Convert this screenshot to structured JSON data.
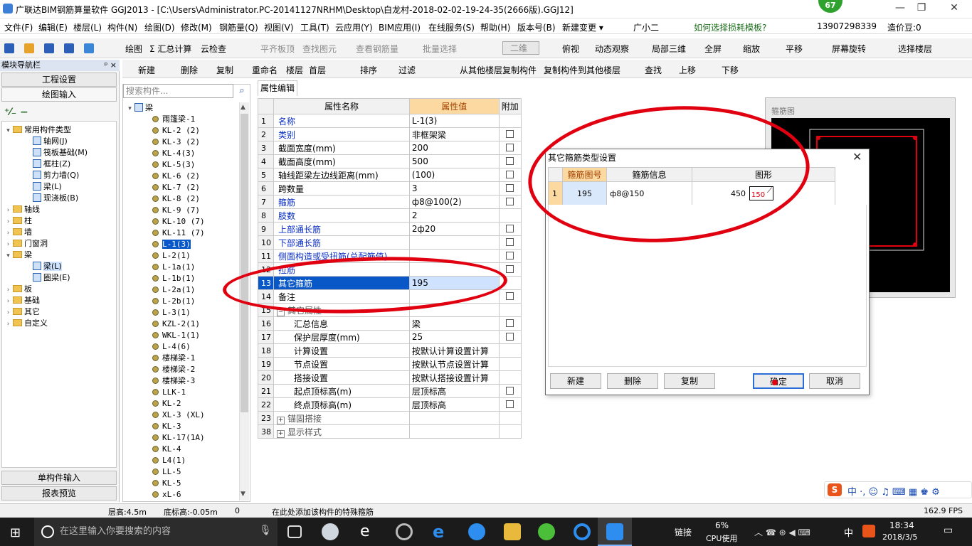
{
  "titlebar": {
    "title": "广联达BIM钢筋算量软件 GGJ2013 - [C:\\Users\\Administrator.PC-20141127NRHM\\Desktop\\白龙村-2018-02-02-19-24-35(2666版).GGJ12]",
    "badge": "67",
    "min": "—",
    "max": "❐",
    "close": "✕"
  },
  "menu": [
    "文件(F)",
    "编辑(E)",
    "楼层(L)",
    "构件(N)",
    "绘图(D)",
    "修改(M)",
    "钢筋量(Q)",
    "视图(V)",
    "工具(T)",
    "云应用(Y)",
    "BIM应用(I)",
    "在线服务(S)",
    "帮助(H)",
    "版本号(B)",
    "新建变更 ▾",
    "广小二",
    "如何选择损耗模板?",
    "13907298339",
    "造价豆:0"
  ],
  "toolbar1": [
    "绘图",
    "Σ 汇总计算",
    "云检查",
    "平齐板顶",
    "查找图元",
    "查看钢筋量",
    "批量选择",
    "二维",
    "俯视",
    "动态观察",
    "局部三维",
    "全屏",
    "缩放",
    "平移",
    "屏幕旋转",
    "选择楼层"
  ],
  "toolbar2": [
    "新建",
    "删除",
    "复制",
    "重命名",
    "楼层",
    "首层",
    "排序",
    "过滤",
    "从其他楼层复制构件",
    "复制构件到其他楼层",
    "查找",
    "上移",
    "下移"
  ],
  "nav": {
    "header": "模块导航栏",
    "pin": "ᵖ ×",
    "btn1": "工程设置",
    "btn2": "绘图输入",
    "btn3": "单构件输入",
    "btn4": "报表预览",
    "tree": [
      {
        "t": "常用构件类型",
        "lvl": 0,
        "f": true,
        "e": "▾"
      },
      {
        "t": "轴网(J)",
        "lvl": 2,
        "f": false,
        "e": ""
      },
      {
        "t": "筏板基础(M)",
        "lvl": 2,
        "f": false,
        "e": ""
      },
      {
        "t": "框柱(Z)",
        "lvl": 2,
        "f": false,
        "e": ""
      },
      {
        "t": "剪力墙(Q)",
        "lvl": 2,
        "f": false,
        "e": ""
      },
      {
        "t": "梁(L)",
        "lvl": 2,
        "f": false,
        "e": ""
      },
      {
        "t": "现浇板(B)",
        "lvl": 2,
        "f": false,
        "e": ""
      },
      {
        "t": "轴线",
        "lvl": 0,
        "f": true,
        "e": "›"
      },
      {
        "t": "柱",
        "lvl": 0,
        "f": true,
        "e": "›"
      },
      {
        "t": "墙",
        "lvl": 0,
        "f": true,
        "e": "›"
      },
      {
        "t": "门窗洞",
        "lvl": 0,
        "f": true,
        "e": "›"
      },
      {
        "t": "梁",
        "lvl": 0,
        "f": true,
        "e": "▾"
      },
      {
        "t": "梁(L)",
        "lvl": 2,
        "f": false,
        "e": ""
      },
      {
        "t": "圈梁(E)",
        "lvl": 2,
        "f": false,
        "e": ""
      },
      {
        "t": "板",
        "lvl": 0,
        "f": true,
        "e": "›"
      },
      {
        "t": "基础",
        "lvl": 0,
        "f": true,
        "e": "›"
      },
      {
        "t": "其它",
        "lvl": 0,
        "f": true,
        "e": "›"
      },
      {
        "t": "自定义",
        "lvl": 0,
        "f": true,
        "e": "›"
      }
    ]
  },
  "list": {
    "search_placeholder": "搜索构件...",
    "root": "梁",
    "items": [
      "雨篷梁-1",
      "KL-2 (2)",
      "KL-3 (2)",
      "KL-4(3)",
      "KL-5(3)",
      "KL-6 (2)",
      "KL-7 (2)",
      "KL-8 (2)",
      "KL-9 (7)",
      "KL-10 (7)",
      "KL-11 (7)",
      "L-1(3)",
      "L-2(1)",
      "L-1a(1)",
      "L-1b(1)",
      "L-2a(1)",
      "L-2b(1)",
      "L-3(1)",
      "KZL-2(1)",
      "WKL-1(1)",
      "L-4(6)",
      "楼梯梁-1",
      "楼梯梁-2",
      "楼梯梁-3",
      "LLK-1",
      "KL-2",
      "XL-3 (XL)",
      "KL-3",
      "KL-17(1A)",
      "KL-4",
      "L4(1)",
      "LL-5",
      "KL-5",
      "xL-6"
    ],
    "selected": 11
  },
  "props": {
    "tab": "属性编辑",
    "h_name": "属性名称",
    "h_value": "属性值",
    "h_extra": "附加",
    "rows": [
      {
        "n": "1",
        "k": "名称",
        "v": "L-1(3)",
        "blue": true,
        "cb": false,
        "ind": 0
      },
      {
        "n": "2",
        "k": "类别",
        "v": "非框架梁",
        "blue": true,
        "cb": true,
        "ind": 0
      },
      {
        "n": "3",
        "k": "截面宽度(mm)",
        "v": "200",
        "blue": false,
        "cb": true,
        "ind": 0
      },
      {
        "n": "4",
        "k": "截面高度(mm)",
        "v": "500",
        "blue": false,
        "cb": true,
        "ind": 0
      },
      {
        "n": "5",
        "k": "轴线距梁左边线距离(mm)",
        "v": "(100)",
        "blue": false,
        "cb": true,
        "ind": 0
      },
      {
        "n": "6",
        "k": "跨数量",
        "v": "3",
        "blue": false,
        "cb": true,
        "ind": 0
      },
      {
        "n": "7",
        "k": "箍筋",
        "v": "ф8@100(2)",
        "blue": true,
        "cb": true,
        "ind": 0
      },
      {
        "n": "8",
        "k": "肢数",
        "v": "2",
        "blue": true,
        "cb": false,
        "ind": 0
      },
      {
        "n": "9",
        "k": "上部通长筋",
        "v": "2ф20",
        "blue": true,
        "cb": true,
        "ind": 0
      },
      {
        "n": "10",
        "k": "下部通长筋",
        "v": "",
        "blue": true,
        "cb": true,
        "ind": 0
      },
      {
        "n": "11",
        "k": "侧面构造或受扭筋(总配筋值)",
        "v": "",
        "blue": true,
        "cb": true,
        "ind": 0
      },
      {
        "n": "12",
        "k": "拉筋",
        "v": "",
        "blue": true,
        "cb": true,
        "ind": 0
      },
      {
        "n": "13",
        "k": "其它箍筋",
        "v": "195",
        "blue": false,
        "cb": false,
        "ind": 0,
        "hl": true
      },
      {
        "n": "14",
        "k": "备注",
        "v": "",
        "blue": false,
        "cb": true,
        "ind": 0
      },
      {
        "n": "15",
        "k": "其它属性",
        "v": "",
        "blue": false,
        "cb": false,
        "ind": 0,
        "grp": "−"
      },
      {
        "n": "16",
        "k": "汇总信息",
        "v": "梁",
        "blue": false,
        "cb": true,
        "ind": 1
      },
      {
        "n": "17",
        "k": "保护层厚度(mm)",
        "v": "25",
        "blue": false,
        "cb": true,
        "ind": 1
      },
      {
        "n": "18",
        "k": "计算设置",
        "v": "按默认计算设置计算",
        "blue": false,
        "cb": false,
        "ind": 1
      },
      {
        "n": "19",
        "k": "节点设置",
        "v": "按默认节点设置计算",
        "blue": false,
        "cb": false,
        "ind": 1
      },
      {
        "n": "20",
        "k": "搭接设置",
        "v": "按默认搭接设置计算",
        "blue": false,
        "cb": false,
        "ind": 1
      },
      {
        "n": "21",
        "k": "起点顶标高(m)",
        "v": "层顶标高",
        "blue": false,
        "cb": true,
        "ind": 1
      },
      {
        "n": "22",
        "k": "终点顶标高(m)",
        "v": "层顶标高",
        "blue": false,
        "cb": true,
        "ind": 1
      },
      {
        "n": "23",
        "k": "锚固搭接",
        "v": "",
        "blue": false,
        "cb": false,
        "ind": 0,
        "grp": "+"
      },
      {
        "n": "38",
        "k": "显示样式",
        "v": "",
        "blue": false,
        "cb": false,
        "ind": 0,
        "grp": "+"
      }
    ]
  },
  "preview": {
    "title": "箍筋图"
  },
  "dialog": {
    "title": "其它箍筋类型设置",
    "close": "✕",
    "h_code": "箍筋图号",
    "h_info": "箍筋信息",
    "h_shape": "图形",
    "row_no": "1",
    "code": "195",
    "info": "ф8@150",
    "dim1": "450",
    "dim2": "150",
    "btn_new": "新建",
    "btn_del": "删除",
    "btn_copy": "复制",
    "btn_ok": "确定",
    "btn_cancel": "取消"
  },
  "status": {
    "floor_h": "层高:4.5m",
    "floor_base": "底标高:-0.05m",
    "zero": "0",
    "hint": "在此处添加该构件的特殊箍筋",
    "fps": "162.9 FPS"
  },
  "taskbar": {
    "search": "在这里输入你要搜索的内容",
    "link": "链接",
    "cpu": "6%",
    "cpu_label": "CPU使用",
    "ime": "中",
    "time": "18:34",
    "date": "2018/3/5"
  },
  "colors": {
    "accent": "#0a58c8",
    "annot": "#e10010",
    "header_orange": "#fcd9a0"
  }
}
